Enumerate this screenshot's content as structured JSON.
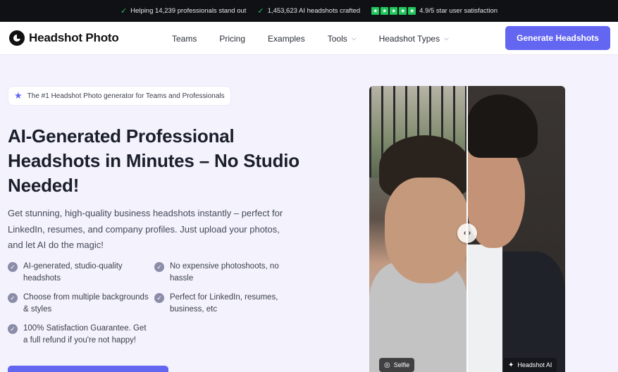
{
  "topbar": {
    "item1": "Helping 14,239 professionals stand out",
    "item2": "1,453,623 AI headshots crafted",
    "rating": "4.9/5 star user satisfaction",
    "accent": "#22c55e"
  },
  "nav": {
    "logo_text": "Headshot Photo",
    "items": [
      {
        "label": "Teams"
      },
      {
        "label": "Pricing"
      },
      {
        "label": "Examples"
      },
      {
        "label": "Tools"
      },
      {
        "label": "Headshot Types"
      }
    ],
    "cta_label": "Generate Headshots",
    "brand_color": "#6366f1"
  },
  "hero": {
    "badge": "The #1 Headshot Photo generator for Teams and Professionals",
    "title": "AI-Generated Professional Headshots in Minutes – No Studio Needed!",
    "subtitle": "Get stunning, high-quality business headshots instantly – perfect for LinkedIn, resumes, and company profiles. Just upload your photos, and let AI do the magic!",
    "features": [
      "AI-generated, studio-quality headshots",
      "No expensive photoshoots, no hassle",
      "Choose from multiple backgrounds & styles",
      "Perfect for LinkedIn, resumes, business, etc",
      "100% Satisfaction Guarantee. Get a full refund if you're not happy!"
    ]
  },
  "compare": {
    "left_label": "Selfie",
    "right_label": "Headshot AI"
  }
}
